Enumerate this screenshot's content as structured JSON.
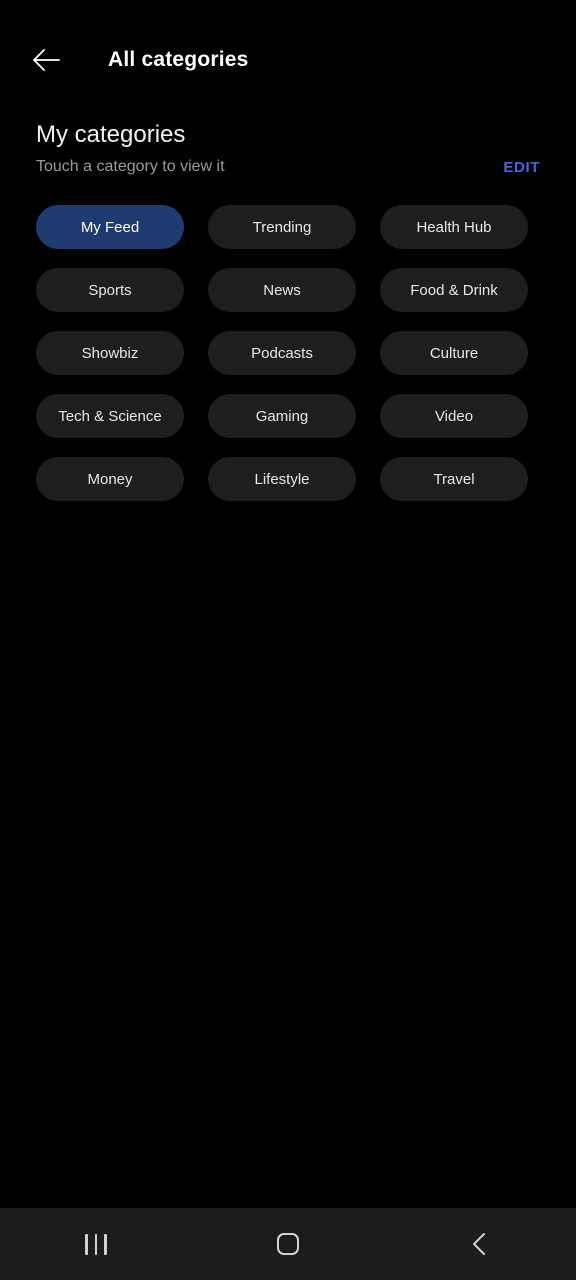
{
  "header": {
    "back_icon": "arrow-left-icon",
    "title": "All categories"
  },
  "section": {
    "heading": "My categories",
    "subtitle": "Touch a category to view it",
    "edit_label": "EDIT",
    "edit_color": "#4267e0"
  },
  "colors": {
    "background": "#000000",
    "chip": "#1e1e1e",
    "chip_selected": "#1d3b6e",
    "nav_bar": "#1c1c1c",
    "text_primary": "#ffffff",
    "text_secondary": "#9a9a9a"
  },
  "categories": [
    {
      "label": "My Feed",
      "selected": true
    },
    {
      "label": "Trending",
      "selected": false
    },
    {
      "label": "Health Hub",
      "selected": false
    },
    {
      "label": "Sports",
      "selected": false
    },
    {
      "label": "News",
      "selected": false
    },
    {
      "label": "Food & Drink",
      "selected": false
    },
    {
      "label": "Showbiz",
      "selected": false
    },
    {
      "label": "Podcasts",
      "selected": false
    },
    {
      "label": "Culture",
      "selected": false
    },
    {
      "label": "Tech & Science",
      "selected": false
    },
    {
      "label": "Gaming",
      "selected": false
    },
    {
      "label": "Video",
      "selected": false
    },
    {
      "label": "Money",
      "selected": false
    },
    {
      "label": "Lifestyle",
      "selected": false
    },
    {
      "label": "Travel",
      "selected": false
    }
  ],
  "nav_bar": {
    "recents_icon": "recents-bars-icon",
    "home_icon": "home-square-icon",
    "back_icon": "chevron-left-icon"
  }
}
